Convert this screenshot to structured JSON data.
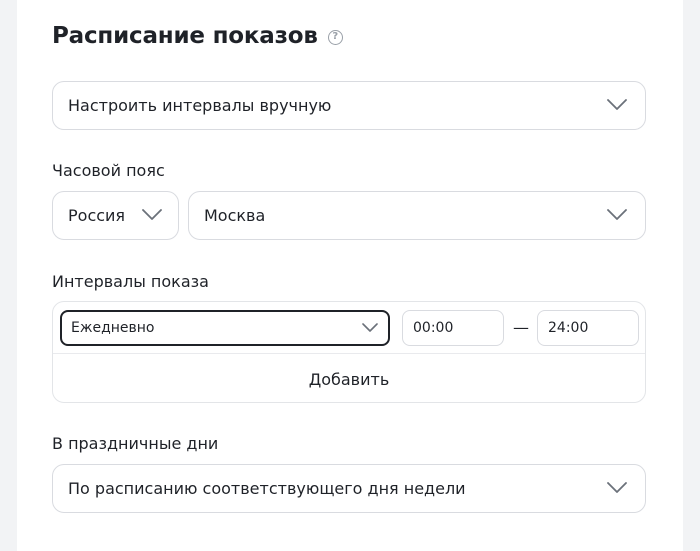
{
  "section": {
    "title": "Расписание показов",
    "help_glyph": "?"
  },
  "schedule_mode": {
    "value": "Настроить интервалы вручную"
  },
  "timezone": {
    "label": "Часовой пояс",
    "country": "Россия",
    "city": "Москва"
  },
  "intervals": {
    "label": "Интервалы показа",
    "rows": [
      {
        "days": "Ежедневно",
        "from": "00:00",
        "separator": "—",
        "to": "24:00"
      }
    ],
    "add_label": "Добавить"
  },
  "holidays": {
    "label": "В праздничные дни",
    "value": "По расписанию соответствующего дня недели"
  },
  "colors": {
    "page_bg": "#f2f3f5",
    "card_bg": "#ffffff",
    "border": "#d9dbe0",
    "text": "#1f2228",
    "icon": "#9aa0a8"
  }
}
